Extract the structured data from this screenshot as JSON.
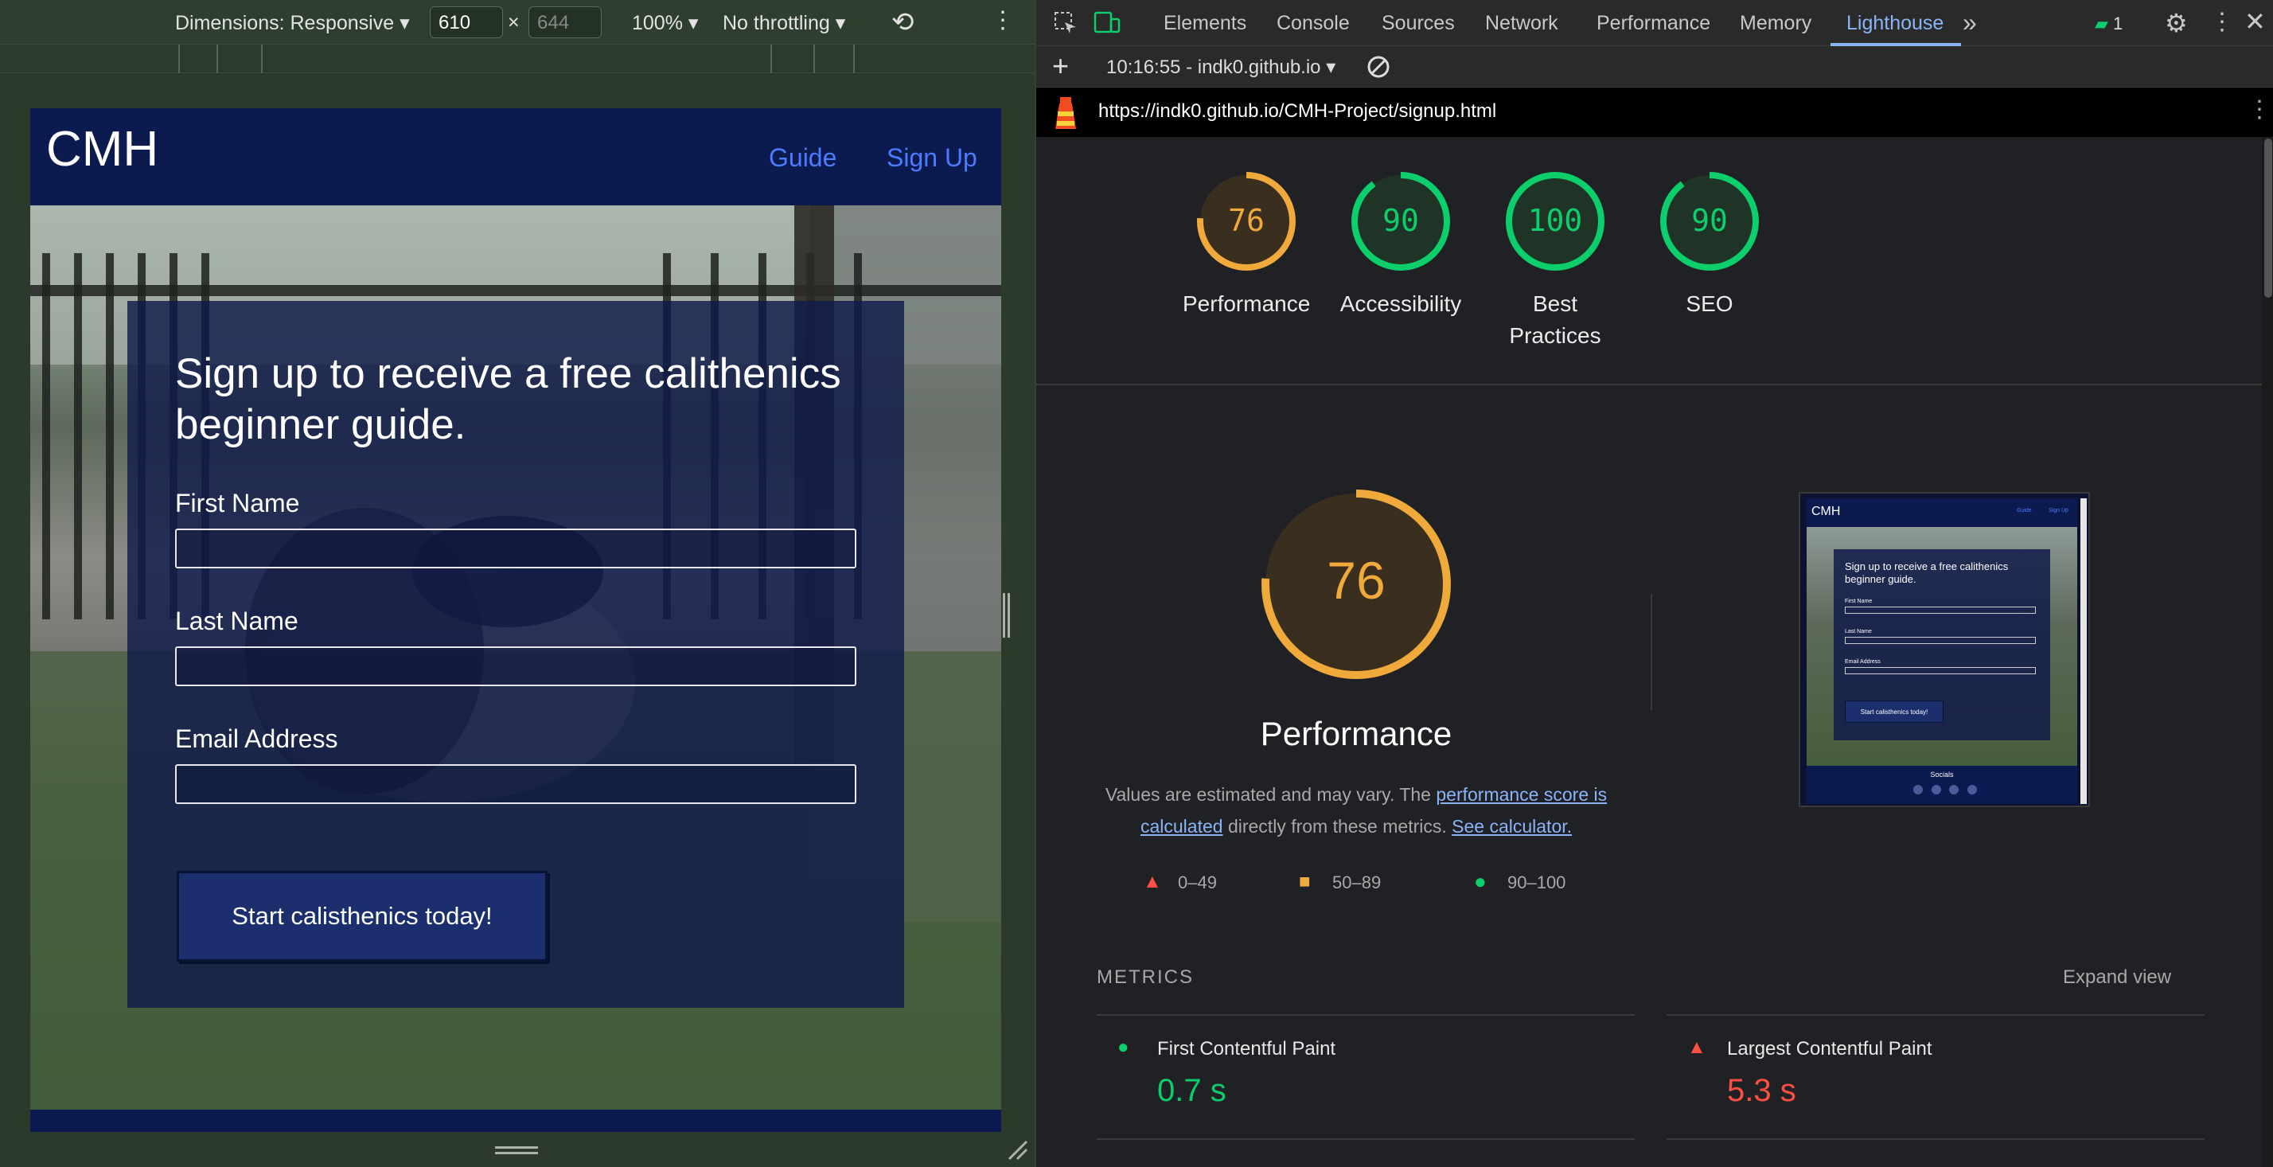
{
  "device_toolbar": {
    "dimensions_label": "Dimensions: Responsive",
    "width_value": "610",
    "times": "×",
    "height_placeholder": "644",
    "zoom": "100%",
    "throttling": "No throttling"
  },
  "site": {
    "logo": "CMH",
    "nav_links": [
      "Guide",
      "Sign Up"
    ],
    "heading": "Sign up to receive a free calithenics beginner guide.",
    "form_labels": [
      "First Name",
      "Last Name",
      "Email Address"
    ],
    "cta_label": "Start calisthenics today!"
  },
  "devtools": {
    "tabs": [
      "Elements",
      "Console",
      "Sources",
      "Network",
      "Performance",
      "Memory",
      "Lighthouse"
    ],
    "active_tab": "Lighthouse",
    "issues_count": "1",
    "report_time": "10:16:55 - indk0.github.io",
    "url": "https://indk0.github.io/CMH-Project/signup.html"
  },
  "scores": [
    {
      "value": 76,
      "label": "Performance",
      "color": "#f0a93b"
    },
    {
      "value": 90,
      "label": "Accessibility",
      "color": "#0cce6b"
    },
    {
      "value": 100,
      "label": "Best Practices",
      "color": "#0cce6b"
    },
    {
      "value": 90,
      "label": "SEO",
      "color": "#0cce6b"
    }
  ],
  "performance": {
    "score": 76,
    "title": "Performance",
    "desc_prefix": "Values are estimated and may vary. The ",
    "desc_link1": "performance score is calculated",
    "desc_middle": " directly from these metrics. ",
    "desc_link2": "See calculator.",
    "legend": [
      "0–49",
      "50–89",
      "90–100"
    ]
  },
  "thumbnail": {
    "logo": "CMH",
    "nav": [
      "Guide",
      "Sign Up"
    ],
    "heading": "Sign up to receive a free calithenics beginner guide.",
    "labels": [
      "First Name",
      "Last Name",
      "Email Address"
    ],
    "button": "Start calisthenics today!",
    "footer": "Socials"
  },
  "metrics": {
    "section_label": "METRICS",
    "expand_label": "Expand view",
    "items": [
      {
        "name": "First Contentful Paint",
        "value": "0.7 s",
        "status": "pass",
        "color": "#0cce6b"
      },
      {
        "name": "Largest Contentful Paint",
        "value": "5.3 s",
        "status": "fail",
        "color": "#ff4e42"
      }
    ]
  },
  "colors": {
    "nav_bg": "#0b1a4f",
    "nav_link": "#4d7bff",
    "lighthouse_tab": "#8ab4f8",
    "pass": "#0cce6b",
    "average": "#f0a93b",
    "fail": "#ff4e42"
  }
}
